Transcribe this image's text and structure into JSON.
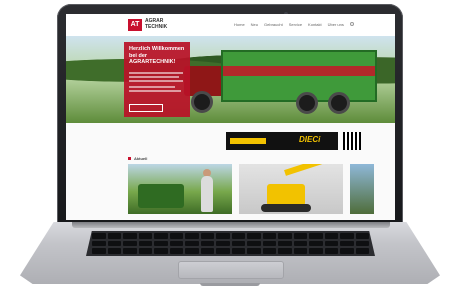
{
  "site": {
    "logo_initials": "AT",
    "logo_name_line1": "AGRAR",
    "logo_name_line2": "TECHNIK",
    "nav_items": [
      "Home",
      "Neu",
      "Gebraucht",
      "Service",
      "Kontakt",
      "Über uns"
    ],
    "hero_title": "Herzlich Willkommen bei der AGRARTECHNIK!",
    "promo_logo": "DIECi",
    "news_label": "Aktuell"
  },
  "colors": {
    "brand_red": "#c8102e",
    "promo_yellow": "#f2c200"
  }
}
